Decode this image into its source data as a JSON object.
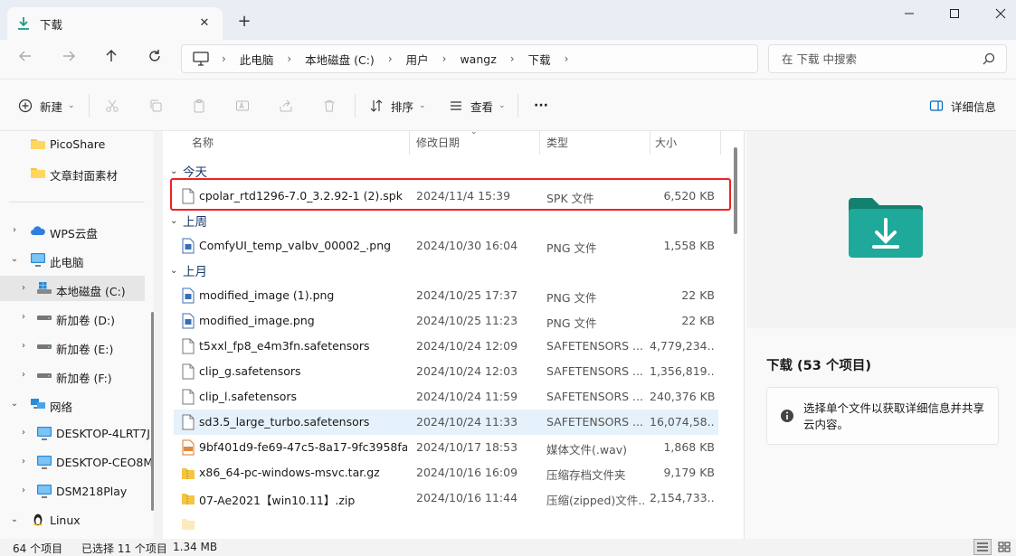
{
  "window": {
    "tab_title": "下载",
    "new_tab_symbol": "+",
    "close_tab_symbol": "✕"
  },
  "address": {
    "breadcrumbs": [
      "此电脑",
      "本地磁盘 (C:)",
      "用户",
      "wangz",
      "下载"
    ],
    "separator": "›",
    "search_placeholder": "在 下载 中搜索"
  },
  "toolbar": {
    "new_label": "新建",
    "sort_label": "排序",
    "view_label": "查看",
    "more_label": "···",
    "details_label": "详细信息"
  },
  "sidebar": {
    "items": [
      {
        "label": "PicoShare",
        "icon": "folder-icon"
      },
      {
        "label": "文章封面素材",
        "icon": "folder-icon"
      },
      {
        "label": "WPS云盘",
        "icon": "cloud-icon"
      },
      {
        "label": "此电脑",
        "icon": "computer-icon"
      },
      {
        "label": "本地磁盘 (C:)",
        "icon": "drive-icon"
      },
      {
        "label": "新加卷 (D:)",
        "icon": "drive-icon"
      },
      {
        "label": "新加卷 (E:)",
        "icon": "drive-icon"
      },
      {
        "label": "新加卷 (F:)",
        "icon": "drive-icon"
      },
      {
        "label": "网络",
        "icon": "network-icon"
      },
      {
        "label": "DESKTOP-4LRT7J",
        "icon": "monitor-icon"
      },
      {
        "label": "DESKTOP-CEO8M",
        "icon": "monitor-icon"
      },
      {
        "label": "DSM218Play",
        "icon": "monitor-icon"
      },
      {
        "label": "Linux",
        "icon": "linux-icon"
      }
    ]
  },
  "columns": {
    "name": "名称",
    "date": "修改日期",
    "type": "类型",
    "size": "大小"
  },
  "groups": {
    "today": "今天",
    "last_week": "上周",
    "last_month": "上月"
  },
  "files": [
    {
      "name": "cpolar_rtd1296-7.0_3.2.92-1 (2).spk",
      "date": "2024/11/4 15:39",
      "type": "SPK 文件",
      "size": "6,520 KB",
      "icon": "file-icon"
    },
    {
      "name": "ComfyUI_temp_valbv_00002_.png",
      "date": "2024/10/30 16:04",
      "type": "PNG 文件",
      "size": "1,558 KB",
      "icon": "image-file-icon"
    },
    {
      "name": "modified_image (1).png",
      "date": "2024/10/25 17:37",
      "type": "PNG 文件",
      "size": "22 KB",
      "icon": "image-file-icon"
    },
    {
      "name": "modified_image.png",
      "date": "2024/10/25 11:23",
      "type": "PNG 文件",
      "size": "22 KB",
      "icon": "image-file-icon"
    },
    {
      "name": "t5xxl_fp8_e4m3fn.safetensors",
      "date": "2024/10/24 12:09",
      "type": "SAFETENSORS ...",
      "size": "4,779,234...",
      "icon": "file-icon"
    },
    {
      "name": "clip_g.safetensors",
      "date": "2024/10/24 12:03",
      "type": "SAFETENSORS ...",
      "size": "1,356,819...",
      "icon": "file-icon"
    },
    {
      "name": "clip_l.safetensors",
      "date": "2024/10/24 11:59",
      "type": "SAFETENSORS ...",
      "size": "240,376 KB",
      "icon": "file-icon"
    },
    {
      "name": "sd3.5_large_turbo.safetensors",
      "date": "2024/10/24 11:33",
      "type": "SAFETENSORS ...",
      "size": "16,074,58...",
      "icon": "file-icon"
    },
    {
      "name": "9bf401d9-fe69-47c5-8a17-9fc3958fa...",
      "date": "2024/10/17 18:53",
      "type": "媒体文件(.wav)",
      "size": "1,868 KB",
      "icon": "audio-file-icon"
    },
    {
      "name": "x86_64-pc-windows-msvc.tar.gz",
      "date": "2024/10/16 16:09",
      "type": "压缩存档文件夹",
      "size": "9,179 KB",
      "icon": "archive-icon"
    },
    {
      "name": "07-Ae2021【win10.11】.zip",
      "date": "2024/10/16 11:44",
      "type": "压缩(zipped)文件...",
      "size": "2,154,733...",
      "icon": "archive-icon"
    }
  ],
  "details": {
    "title": "下载 (53 个项目)",
    "info": "选择单个文件以获取详细信息并共享云内容。"
  },
  "status": {
    "count": "64 个项目",
    "selected": "已选择 11 个项目",
    "size": "1.34 MB"
  },
  "colors": {
    "accent": "#0067c0",
    "highlight_border": "#e22222",
    "folder_teal": "#1fa99a",
    "folder_yellow": "#f5c542"
  }
}
